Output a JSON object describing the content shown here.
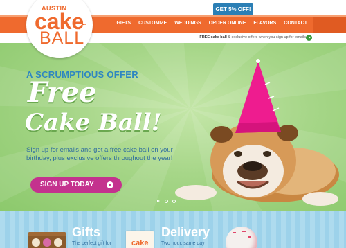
{
  "header": {
    "promo_tab": "GET 5% OFF!",
    "nav": [
      "GIFTS",
      "CUSTOMIZE",
      "WEDDINGS",
      "ORDER ONLINE",
      "FLAVORS",
      "CONTACT"
    ],
    "subbar_bold": "FREE cake ball",
    "subbar_rest": " & exclusive offers when you sign up for emails",
    "logo_top": "AUSTIN",
    "logo_mid": "cake",
    "logo_bottom": "BALL"
  },
  "hero": {
    "offer_heading": "A SCRUMPTIOUS OFFER",
    "free": "Free",
    "cake_ball": "Cake Ball!",
    "description": "Sign up for emails and get a free cake ball on your birthday, plus exclusive offers throughout the year!",
    "cta": "SIGN UP TODAY"
  },
  "bottom": {
    "gifts_title": "Gifts",
    "gifts_sub": "The perfect gift for",
    "delivery_title": "Delivery",
    "delivery_sub": "Two hour, same day",
    "bag_label": "cake"
  },
  "colors": {
    "orange": "#ef6a2e",
    "blue": "#2b7fb5",
    "green": "#a6d688",
    "magenta": "#c4328e",
    "pink_hat": "#ee1c8f"
  }
}
